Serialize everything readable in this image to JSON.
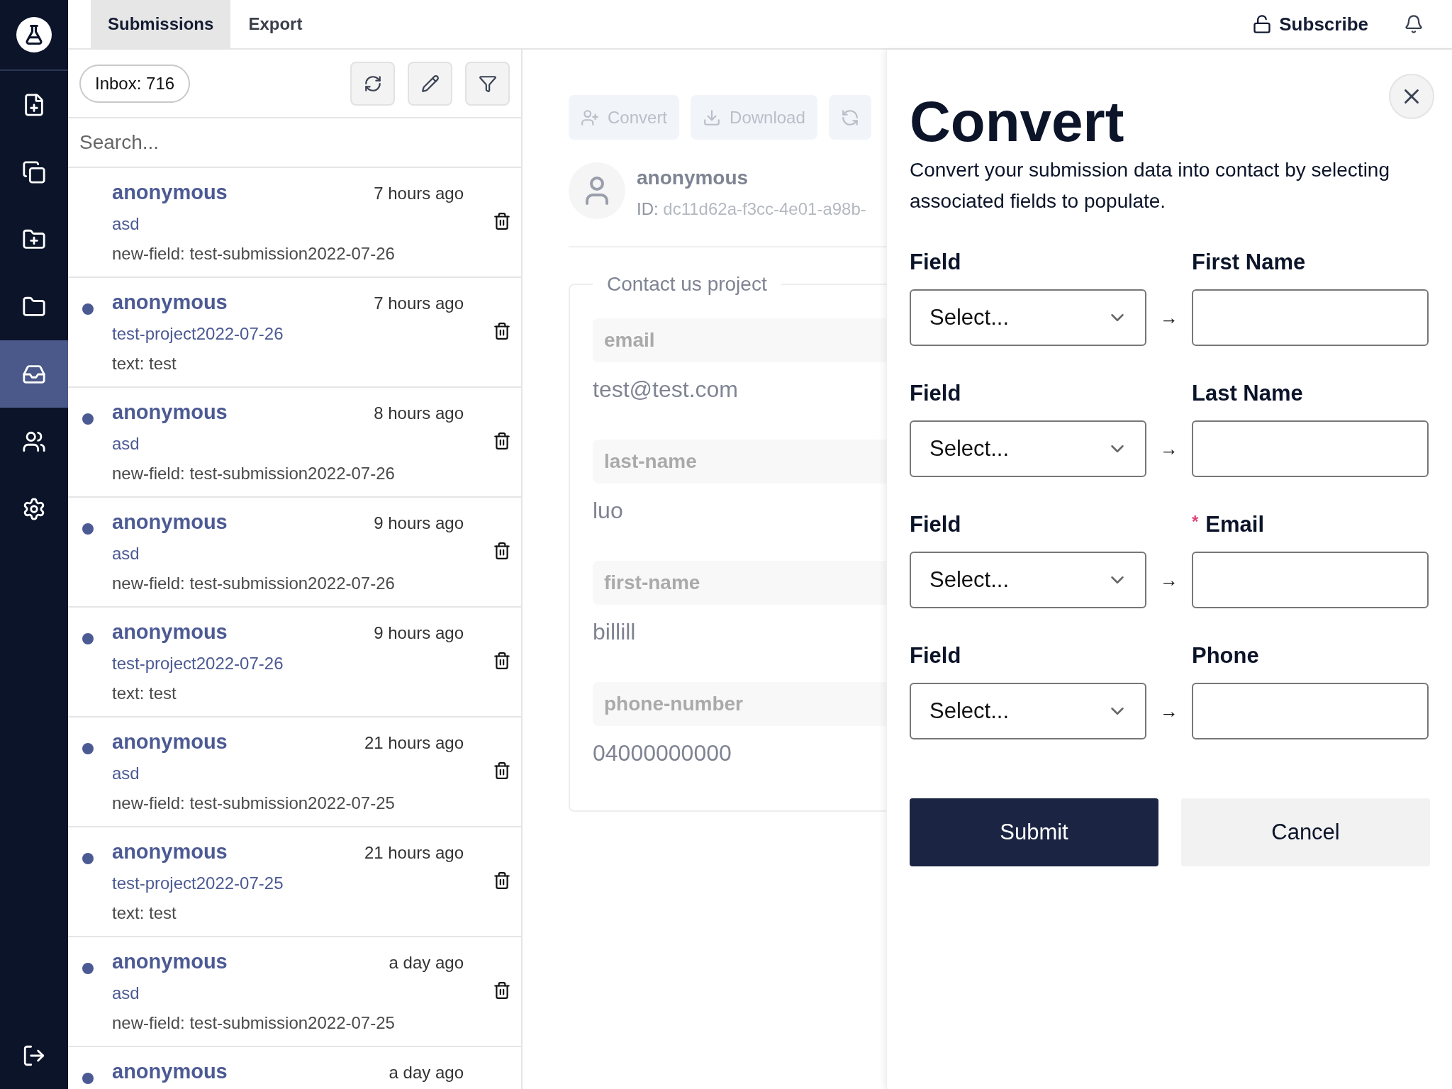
{
  "sidebar": {
    "items": [
      {
        "selected": false
      },
      {
        "selected": false
      },
      {
        "selected": false
      },
      {
        "selected": false
      },
      {
        "selected": true
      },
      {
        "selected": false
      },
      {
        "selected": false
      }
    ]
  },
  "header": {
    "tabs": [
      {
        "label": "Submissions",
        "selected": true
      },
      {
        "label": "Export",
        "selected": false
      }
    ],
    "subscribe": "Subscribe"
  },
  "list": {
    "inbox": "Inbox: 716",
    "search": {
      "placeholder": "Search..."
    },
    "items": [
      {
        "name": "anonymous",
        "time": "7 hours ago",
        "project": "asd",
        "detail": "new-field: test-submission2022-07-26",
        "unread": false
      },
      {
        "name": "anonymous",
        "time": "7 hours ago",
        "project": "test-project2022-07-26",
        "detail": "text: test",
        "unread": true
      },
      {
        "name": "anonymous",
        "time": "8 hours ago",
        "project": "asd",
        "detail": "new-field: test-submission2022-07-26",
        "unread": true
      },
      {
        "name": "anonymous",
        "time": "9 hours ago",
        "project": "asd",
        "detail": "new-field: test-submission2022-07-26",
        "unread": true
      },
      {
        "name": "anonymous",
        "time": "9 hours ago",
        "project": "test-project2022-07-26",
        "detail": "text: test",
        "unread": true
      },
      {
        "name": "anonymous",
        "time": "21 hours ago",
        "project": "asd",
        "detail": "new-field: test-submission2022-07-25",
        "unread": true
      },
      {
        "name": "anonymous",
        "time": "21 hours ago",
        "project": "test-project2022-07-25",
        "detail": "text: test",
        "unread": true
      },
      {
        "name": "anonymous",
        "time": "a day ago",
        "project": "asd",
        "detail": "new-field: test-submission2022-07-25",
        "unread": true
      },
      {
        "name": "anonymous",
        "time": "a day ago",
        "unread": true
      }
    ]
  },
  "detail": {
    "actions": [
      {
        "kind": "convert",
        "label": "Convert"
      },
      {
        "kind": "download",
        "label": "Download"
      },
      {
        "kind": "refresh"
      }
    ],
    "name": "anonymous",
    "id_label": "ID:",
    "id": "dc11d62a-f3cc-4e01-a98b-",
    "project": "Contact us project",
    "fields": [
      {
        "label": "email",
        "value": "test@test.com"
      },
      {
        "label": "last-name",
        "value": "luo"
      },
      {
        "label": "first-name",
        "value": "billill"
      },
      {
        "label": "phone-number",
        "value": "04000000000"
      }
    ]
  },
  "drawer": {
    "title": "Convert",
    "description": "Convert your submission data into contact by selecting associated fields to populate.",
    "rows": [
      {
        "field_label": "Field",
        "select": "Select...",
        "target": "First Name",
        "required": false
      },
      {
        "field_label": "Field",
        "select": "Select...",
        "target": "Last Name",
        "required": false
      },
      {
        "field_label": "Field",
        "select": "Select...",
        "target": "Email",
        "required": true
      },
      {
        "field_label": "Field",
        "select": "Select...",
        "target": "Phone",
        "required": false
      }
    ],
    "required_mark": "*",
    "arrow": "→",
    "submit": "Submit",
    "cancel": "Cancel"
  }
}
